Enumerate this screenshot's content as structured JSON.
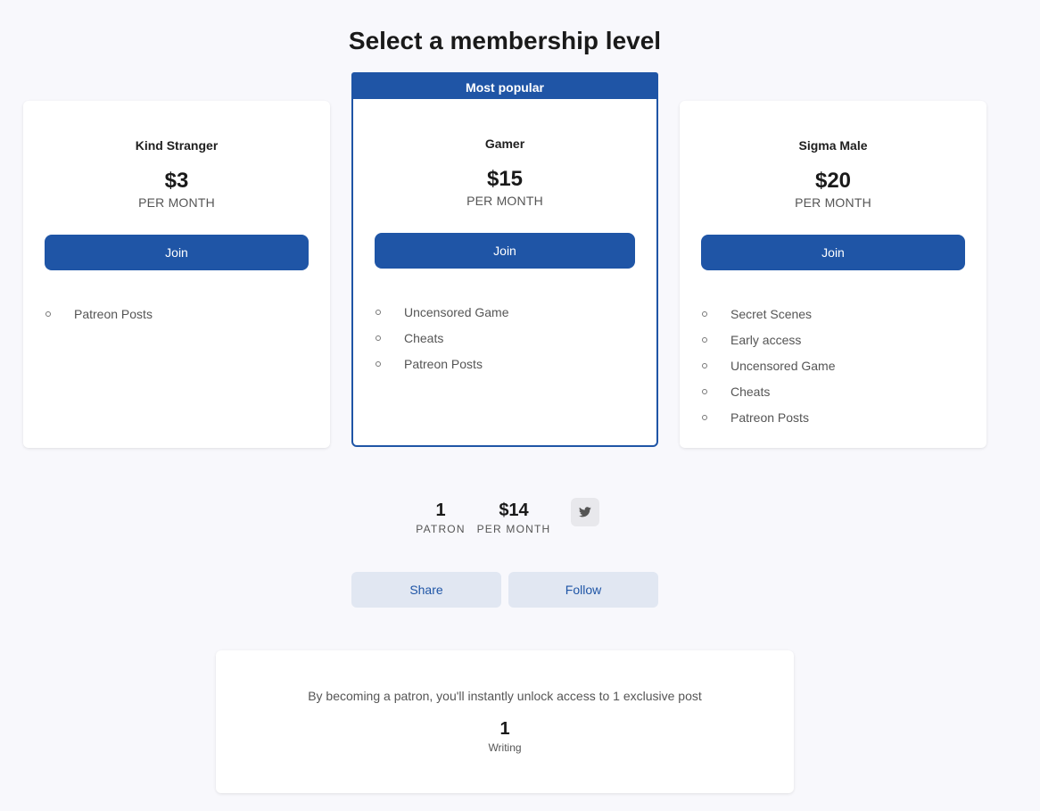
{
  "page": {
    "title": "Select a membership level"
  },
  "tiers": [
    {
      "name": "Kind Stranger",
      "price": "$3",
      "period": "PER MONTH",
      "join_label": "Join",
      "benefits": [
        "Patreon Posts"
      ]
    },
    {
      "badge": "Most popular",
      "name": "Gamer",
      "price": "$15",
      "period": "PER MONTH",
      "join_label": "Join",
      "benefits": [
        "Uncensored Game",
        "Cheats",
        "Patreon Posts"
      ]
    },
    {
      "name": "Sigma Male",
      "price": "$20",
      "period": "PER MONTH",
      "join_label": "Join",
      "benefits": [
        "Secret Scenes",
        "Early access",
        "Uncensored Game",
        "Cheats",
        "Patreon Posts"
      ]
    }
  ],
  "stats": {
    "patrons": {
      "value": "1",
      "label": "PATRON"
    },
    "monthly": {
      "value": "$14",
      "label": "PER MONTH"
    },
    "share_icon": "twitter-icon"
  },
  "actions": {
    "share_label": "Share",
    "follow_label": "Follow"
  },
  "unlock": {
    "text": "By becoming a patron, you'll instantly unlock access to 1 exclusive post",
    "count": "1",
    "type": "Writing"
  },
  "colors": {
    "accent": "#1f55a6",
    "background": "#f8f8fc",
    "secondary_button": "#e1e7f2"
  }
}
